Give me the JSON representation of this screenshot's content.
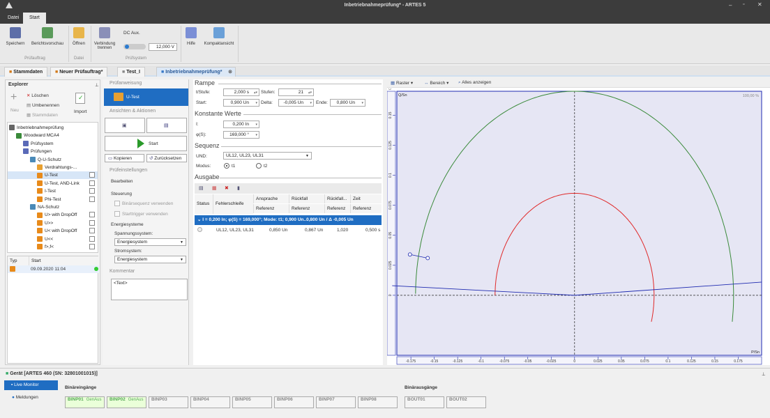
{
  "window": {
    "title": "Inbetriebnahmeprüfung* - ARTES 5"
  },
  "menu": {
    "file": "Datei",
    "start": "Start"
  },
  "ribbon": {
    "save": "Speichern",
    "report_preview": "Berichtsvorschau",
    "open": "Öffnen",
    "disconnect": "Verbindung trennen",
    "dc_aux": "DC Aux.",
    "dc_value": "12,000 V",
    "help": "Hilfe",
    "compact": "Kompaktansicht",
    "grp_test": "Prüfauftrag",
    "grp_file": "Datei",
    "grp_system": "Prüfsystem"
  },
  "doctabs": [
    "Stammdaten",
    "Neuer Prüfauftrag*",
    "Test_I",
    "Inbetriebnahmeprüfung*"
  ],
  "explorer": {
    "title": "Explorer",
    "delete": "Löschen",
    "rename": "Umbenennen",
    "master": "Stammdaten",
    "new": "Neu",
    "import": "Import",
    "tree": [
      "Inbetriebnahmeprüfung",
      "Woodward MCA4",
      "Prüfsystem",
      "Prüfungen",
      "Q-U-Schutz",
      "Verdrahtungs-...",
      "U-Test",
      "U-Test, AND-Link",
      "I-Test",
      "Phi-Test",
      "NA-Schutz",
      "U> with DropOff",
      "U>>",
      "U< with DropOff",
      "U<<",
      "f>,f<"
    ],
    "hist_type": "Typ",
    "hist_start": "Start",
    "hist_date": "09.09.2020 11:04"
  },
  "middle": {
    "instr": "Prüfanweisung",
    "test": "U-Test",
    "views": "Ansichten & Aktionen",
    "start": "Start",
    "copy": "Kopieren",
    "reset": "Zurücksetzen",
    "settings": "Prüfeinstellungen",
    "edit": "Bearbeiten",
    "control": "Steuerung",
    "bin_seq": "Binärsequenz verwenden",
    "start_trig": "Starttrigger verwenden",
    "energy": "Energiesysteme",
    "voltage_sys": "Spannungssystem:",
    "energy_val1": "Energiesystem",
    "current_sys": "Stromsystem:",
    "energy_val2": "Energiesystem",
    "comment": "Kommentar",
    "comment_text": "<Text>"
  },
  "params": {
    "ramp": "Rampe",
    "tstep": "t/Stufe:",
    "tstep_v": "2,000 s",
    "steps": "Stufen:",
    "steps_v": "21",
    "start": "Start:",
    "start_v": "0,900 Un",
    "delta": "Delta:",
    "delta_v": "-0,005 Un",
    "end": "Ende:",
    "end_v": "0,800 Un",
    "const": "Konstante Werte",
    "i": "I:",
    "i_v": "0,200 In",
    "phi": "φ(S):",
    "phi_v": "169,000 °",
    "seq": "Sequenz",
    "und": "UND:",
    "und_v": "UL12, UL23, UL31",
    "mode": "Modus:",
    "t1": "t1",
    "t2": "t2",
    "output": "Ausgabe"
  },
  "table": {
    "h_status": "Status",
    "h_fault": "Fehlerschleife",
    "h_pickup": "Ansprache",
    "h_dropoff": "Rückfall",
    "h_ratio": "Rückfall...",
    "h_time": "Zeit",
    "sub_ref": "Referenz",
    "group": "I = 0,200 In; φ(S) = 169,000°; Mode: t1; 0,900 Un..0,800 Un / Δ -0,005 Un",
    "row": {
      "loop": "UL12, UL23, UL31",
      "pickup": "0,850 Un",
      "dropoff": "0,867 Un",
      "ratio": "1,020",
      "time": "0,500 s"
    }
  },
  "chart": {
    "raster": "Raster",
    "range": "Bereich",
    "show_all": "Alles anzeigen",
    "ylabel": "Q/Sn",
    "xlabel": "P/Sn",
    "zoom": "100,00 %",
    "xticks": [
      "-0.175",
      "-0.15",
      "-0.125",
      "-0.1",
      "-0.075",
      "-0.05",
      "-0.025",
      "0",
      "0.025",
      "0.05",
      "0.075",
      "0.1",
      "0.125",
      "0.15",
      "0.175"
    ],
    "yticks": [
      "0.175",
      "0.15",
      "0.125",
      "0.1",
      "0.075",
      "0.05",
      "0.025",
      "0"
    ]
  },
  "chart_data": {
    "type": "scatter",
    "x_range": [
      -0.19,
      0.2
    ],
    "y_range": [
      -0.05,
      0.17
    ],
    "outer_circle_r": 0.17,
    "inner_circle_r": 0.085,
    "colors": {
      "outer": "#3a8a3a",
      "inner": "#e02828",
      "line": "#1e2ab0"
    }
  },
  "device": {
    "title": "Gerät [ARTES 460 (SN: 32801001015)]",
    "live": "Live Monitor",
    "messages": "Meldungen",
    "bin_in": "Binäreingänge",
    "bin_out": "Binärausgänge",
    "inputs": [
      {
        "n": "BINP01",
        "s": "GenAus"
      },
      {
        "n": "BINP02",
        "s": "GenAus"
      },
      {
        "n": "BINP03",
        "s": ""
      },
      {
        "n": "BINP04",
        "s": ""
      },
      {
        "n": "BINP05",
        "s": ""
      },
      {
        "n": "BINP06",
        "s": ""
      },
      {
        "n": "BINP07",
        "s": ""
      },
      {
        "n": "BINP08",
        "s": ""
      }
    ],
    "outputs": [
      "BOUT01",
      "BOUT02"
    ]
  }
}
